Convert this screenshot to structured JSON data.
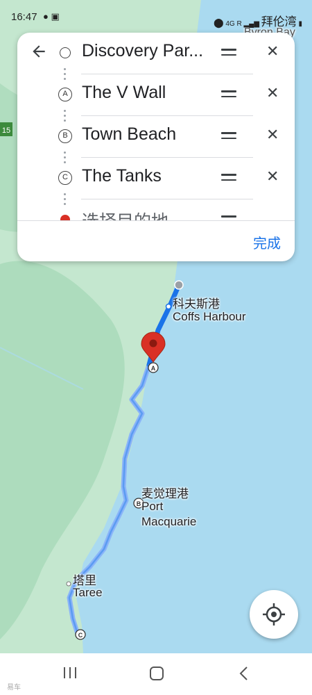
{
  "status_bar": {
    "time": "16:47",
    "network": "4G R",
    "right_overlay_text": "拜伦湾",
    "icons": [
      "wechat-icon",
      "image-icon",
      "location-icon",
      "signal-icon",
      "battery-icon"
    ]
  },
  "directions_panel": {
    "back_icon": "arrow-back-icon",
    "stops": [
      {
        "marker": "",
        "label": "Discovery Par...",
        "type": "origin"
      },
      {
        "marker": "A",
        "label": "The V Wall",
        "type": "waypoint"
      },
      {
        "marker": "B",
        "label": "Town Beach",
        "type": "waypoint"
      },
      {
        "marker": "C",
        "label": "The Tanks",
        "type": "waypoint"
      },
      {
        "marker": "",
        "label": "选择目的地",
        "type": "destination"
      }
    ],
    "drag_icon": "drag-handle-icon",
    "remove_icon": "close-icon",
    "done_label": "完成"
  },
  "map": {
    "labels": {
      "byron_bay": "Byron Bay",
      "coffs_cn": "科夫斯港",
      "coffs_en": "Coffs Harbour",
      "pm_cn": "麦觉理港",
      "pm_en1": "Port",
      "pm_en2": "Macquarie",
      "taree_cn": "塔里",
      "taree_en": "Taree",
      "road_shield": "15"
    },
    "colors": {
      "water": "#aadaf0",
      "land": "#bfe6cf",
      "route": "#1a73e8",
      "alt_route": "#8ab4f8",
      "pin": "#d93025"
    },
    "locate_icon": "my-location-icon"
  },
  "nav_bar": {
    "recent_icon": "recent-apps-icon",
    "home_icon": "home-icon",
    "back_icon": "back-icon",
    "watermark": "易车"
  }
}
